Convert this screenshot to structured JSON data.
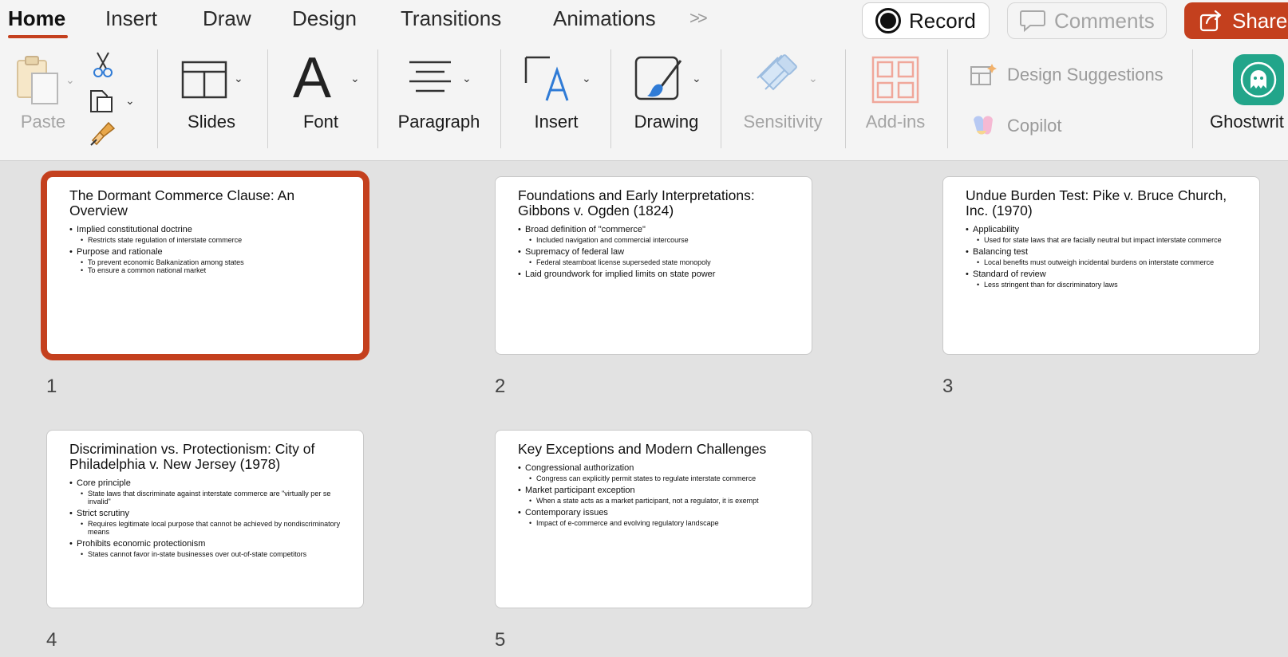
{
  "tabs": [
    {
      "label": "Home",
      "active": true
    },
    {
      "label": "Insert",
      "active": false
    },
    {
      "label": "Draw",
      "active": false
    },
    {
      "label": "Design",
      "active": false
    },
    {
      "label": "Transitions",
      "active": false
    },
    {
      "label": "Animations",
      "active": false
    }
  ],
  "more_tabs_glyph": ">>",
  "header_buttons": {
    "record": "Record",
    "comments": "Comments",
    "share": "Share"
  },
  "toolbar": {
    "paste": "Paste",
    "slides": "Slides",
    "font": "Font",
    "paragraph": "Paragraph",
    "insert": "Insert",
    "drawing": "Drawing",
    "sensitivity": "Sensitivity",
    "addins": "Add-ins",
    "design_suggestions": "Design Suggestions",
    "copilot": "Copilot",
    "ghostwriter": "Ghostwrit",
    "font_glyph": "A"
  },
  "colors": {
    "accent": "#c4401e",
    "ghost_tile": "#22a58a",
    "draw_blue": "#2f7bd6"
  },
  "slides": [
    {
      "number": "1",
      "selected": true,
      "title": "The Dormant Commerce Clause: An Overview",
      "bullets": [
        {
          "text": "Implied constitutional doctrine",
          "subs": [
            "Restricts state regulation of interstate commerce"
          ]
        },
        {
          "text": "Purpose and rationale",
          "subs": [
            "To prevent economic Balkanization among states",
            "To ensure a common national market"
          ]
        }
      ]
    },
    {
      "number": "2",
      "selected": false,
      "title": "Foundations and Early Interpretations: Gibbons v. Ogden (1824)",
      "bullets": [
        {
          "text": "Broad definition of \"commerce\"",
          "subs": [
            "Included navigation and commercial intercourse"
          ]
        },
        {
          "text": "Supremacy of federal law",
          "subs": [
            "Federal steamboat license superseded state monopoly"
          ]
        },
        {
          "text": "Laid groundwork for implied limits on state power",
          "subs": []
        }
      ]
    },
    {
      "number": "3",
      "selected": false,
      "title": "Undue Burden Test: Pike v. Bruce Church, Inc. (1970)",
      "bullets": [
        {
          "text": "Applicability",
          "subs": [
            "Used for state laws that are facially neutral but impact interstate commerce"
          ]
        },
        {
          "text": "Balancing test",
          "subs": [
            "Local benefits must outweigh incidental burdens on interstate commerce"
          ]
        },
        {
          "text": "Standard of review",
          "subs": [
            "Less stringent than for discriminatory laws"
          ]
        }
      ]
    },
    {
      "number": "4",
      "selected": false,
      "title": "Discrimination vs. Protectionism: City of Philadelphia v. New Jersey (1978)",
      "bullets": [
        {
          "text": "Core principle",
          "subs": [
            "State laws that discriminate against interstate commerce are \"virtually per se invalid\""
          ]
        },
        {
          "text": "Strict scrutiny",
          "subs": [
            "Requires legitimate local purpose that cannot be achieved by nondiscriminatory means"
          ]
        },
        {
          "text": "Prohibits economic protectionism",
          "subs": [
            "States cannot favor in-state businesses over out-of-state competitors"
          ]
        }
      ]
    },
    {
      "number": "5",
      "selected": false,
      "title": "Key Exceptions and Modern Challenges",
      "bullets": [
        {
          "text": "Congressional authorization",
          "subs": [
            "Congress can explicitly permit states to regulate interstate commerce"
          ]
        },
        {
          "text": "Market participant exception",
          "subs": [
            "When a state acts as a market participant, not a regulator, it is exempt"
          ]
        },
        {
          "text": "Contemporary issues",
          "subs": [
            "Impact of e-commerce and evolving regulatory landscape"
          ]
        }
      ]
    }
  ]
}
